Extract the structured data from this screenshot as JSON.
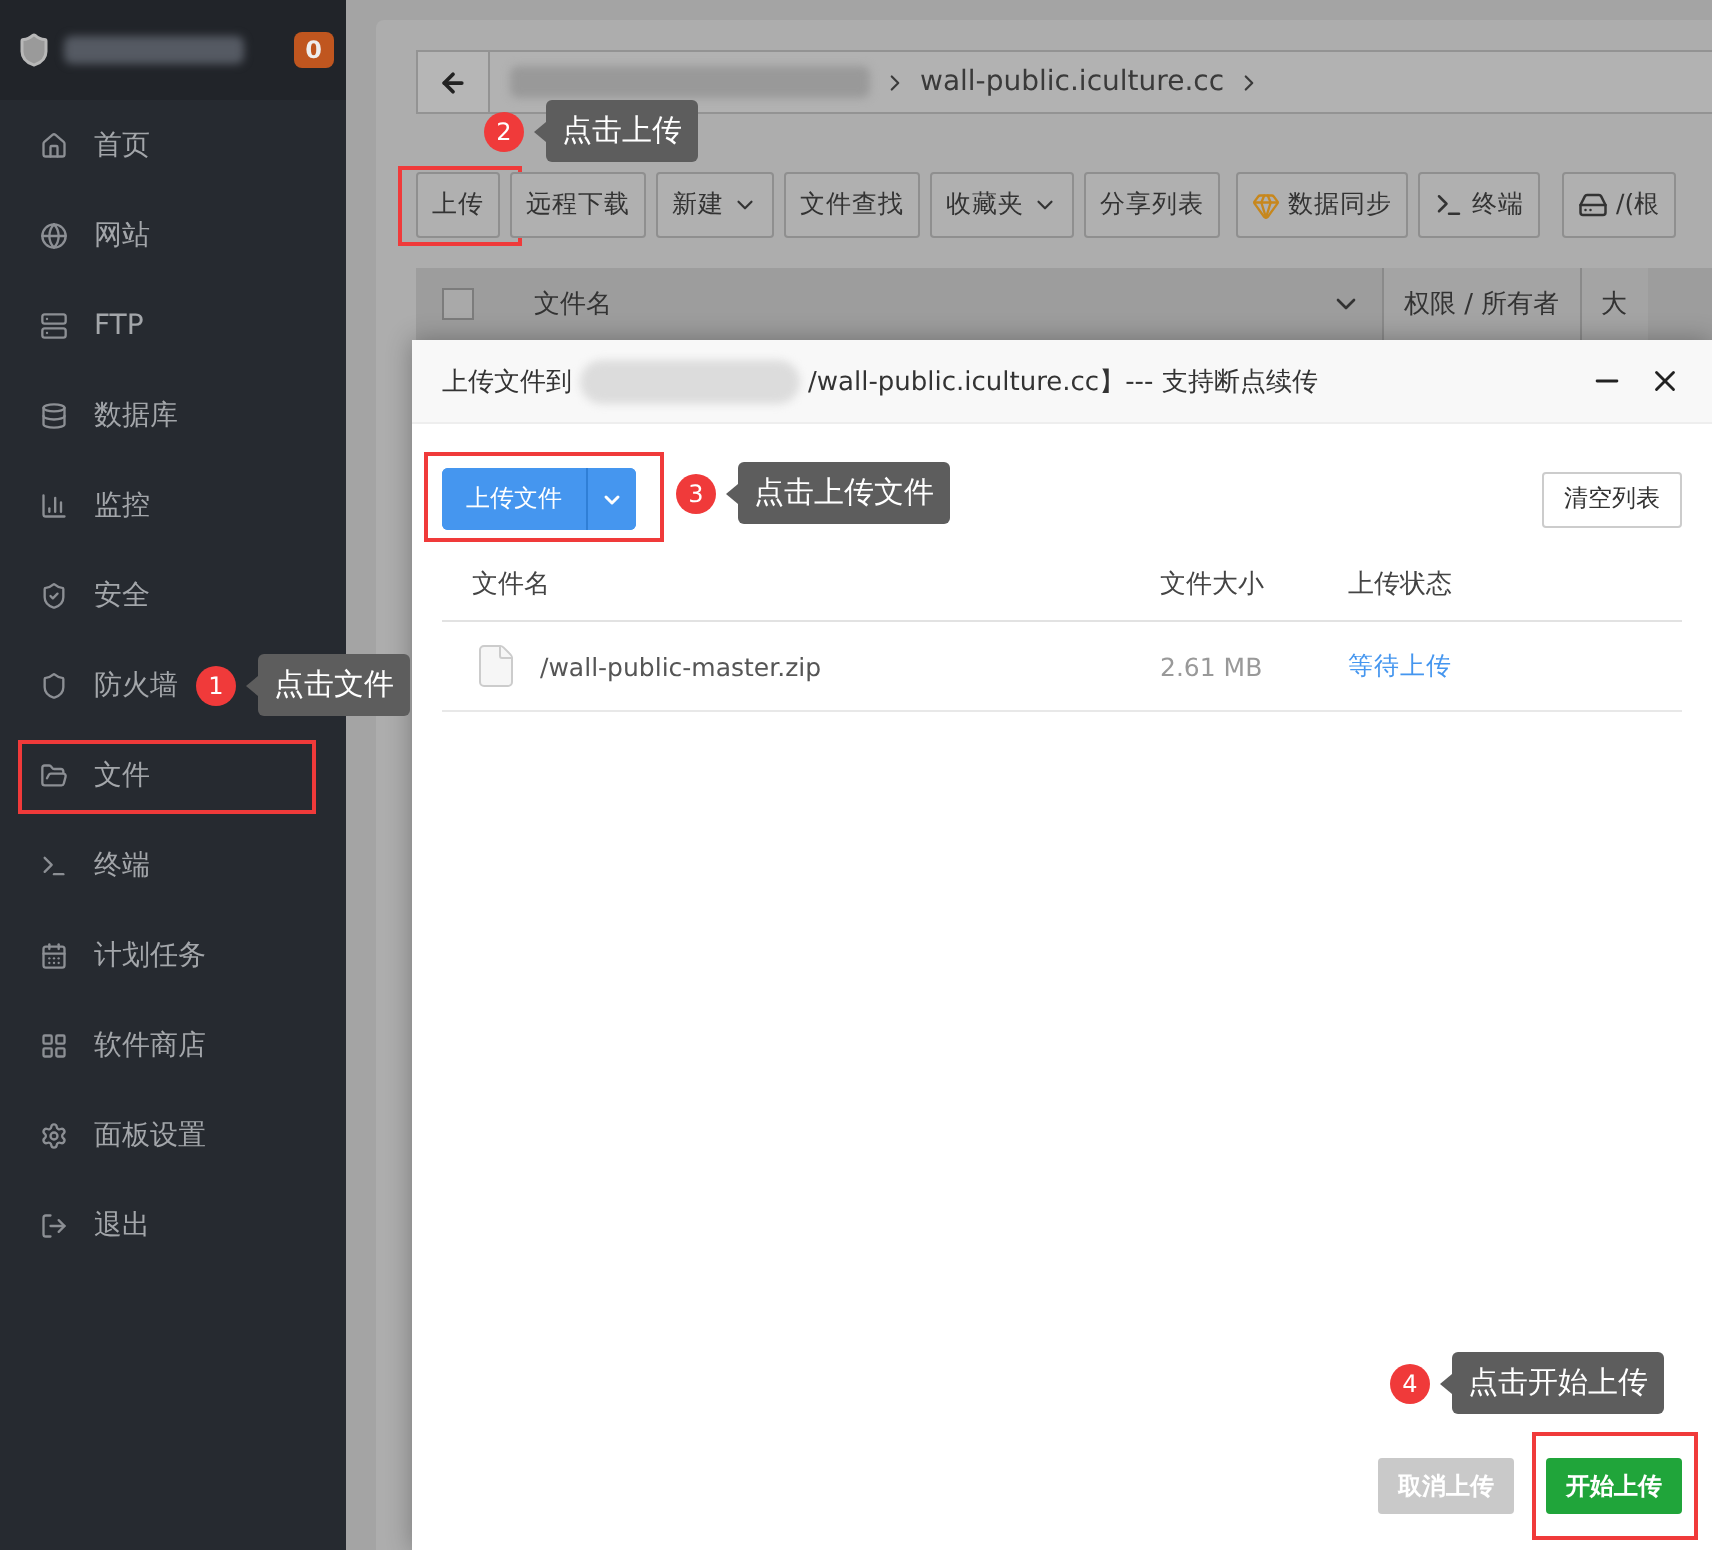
{
  "sidebar": {
    "badge": "0",
    "items": [
      {
        "label": "首页",
        "highlighted": false
      },
      {
        "label": "网站",
        "highlighted": false
      },
      {
        "label": "FTP",
        "highlighted": false
      },
      {
        "label": "数据库",
        "highlighted": false
      },
      {
        "label": "监控",
        "highlighted": false
      },
      {
        "label": "安全",
        "highlighted": false
      },
      {
        "label": "防火墙",
        "highlighted": false
      },
      {
        "label": "文件",
        "highlighted": true
      },
      {
        "label": "终端",
        "highlighted": false
      },
      {
        "label": "计划任务",
        "highlighted": false
      },
      {
        "label": "软件商店",
        "highlighted": false
      },
      {
        "label": "面板设置",
        "highlighted": false
      },
      {
        "label": "退出",
        "highlighted": false
      }
    ]
  },
  "breadcrumb": {
    "segments": [
      "wall-public.iculture.cc"
    ]
  },
  "toolbar": [
    {
      "label": "上传",
      "kind": "plain",
      "highlighted": true
    },
    {
      "label": "远程下载",
      "kind": "plain",
      "highlighted": false
    },
    {
      "label": "新建",
      "kind": "dropdown",
      "highlighted": false
    },
    {
      "label": "文件查找",
      "kind": "plain",
      "highlighted": false
    },
    {
      "label": "收藏夹",
      "kind": "dropdown",
      "highlighted": false
    },
    {
      "label": "分享列表",
      "kind": "plain",
      "highlighted": false
    },
    {
      "label": "数据同步",
      "kind": "gem",
      "highlighted": false
    },
    {
      "label": "终端",
      "kind": "terminal",
      "highlighted": false
    },
    {
      "label": "/(根",
      "kind": "disk",
      "highlighted": false
    }
  ],
  "file_table": {
    "select_all_checked": false,
    "columns": [
      "文件名",
      "权限 / 所有者",
      "大"
    ]
  },
  "upload_dialog": {
    "title_prefix": "上传文件到",
    "title_suffix": "/wall-public.iculture.cc】--- 支持断点续传",
    "upload_button": {
      "label": "上传文件",
      "highlighted": true
    },
    "clear_button": "清空列表",
    "columns": [
      "文件名",
      "文件大小",
      "上传状态"
    ],
    "files": [
      {
        "name": "/wall-public-master.zip",
        "size": "2.61 MB",
        "status": "等待上传"
      }
    ],
    "cancel_button": {
      "label": "取消上传",
      "disabled": true
    },
    "start_button": {
      "label": "开始上传",
      "highlighted": true
    }
  },
  "annotations": [
    {
      "number": "1",
      "text": "点击文件"
    },
    {
      "number": "2",
      "text": "点击上传"
    },
    {
      "number": "3",
      "text": "点击上传文件"
    },
    {
      "number": "4",
      "text": "点击开始上传"
    }
  ]
}
